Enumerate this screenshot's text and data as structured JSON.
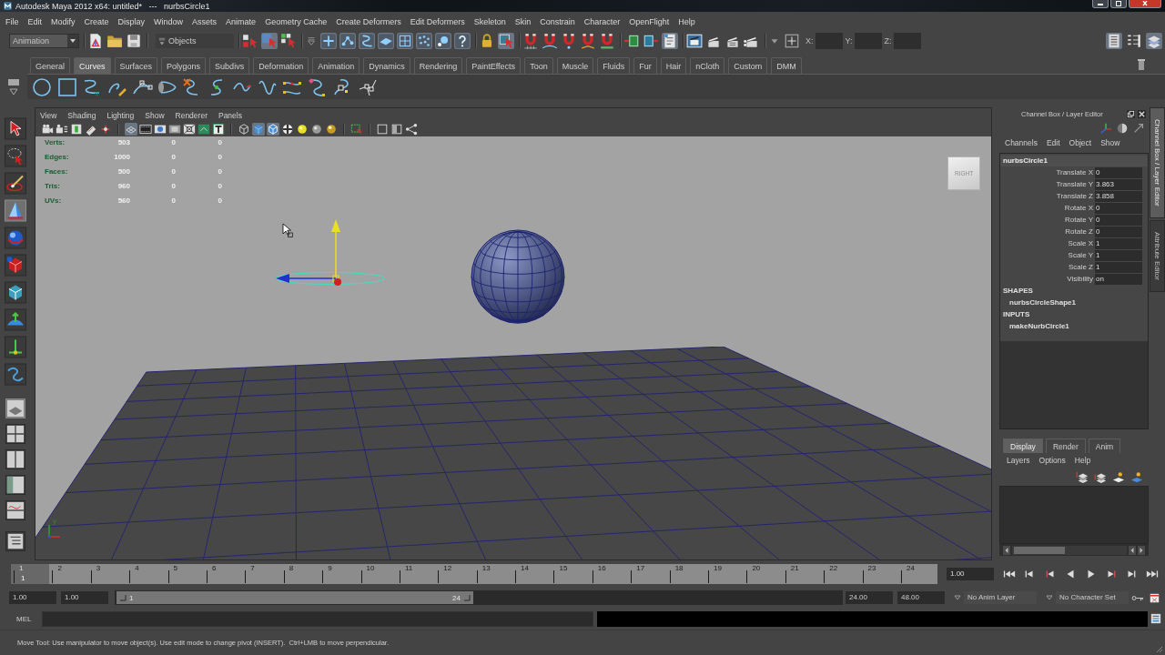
{
  "window": {
    "title": "Autodesk Maya 2012 x64: untitled*   ---   nurbsCircle1"
  },
  "menu_bar": [
    "File",
    "Edit",
    "Modify",
    "Create",
    "Display",
    "Window",
    "Assets",
    "Animate",
    "Geometry Cache",
    "Create Deformers",
    "Edit Deformers",
    "Skeleton",
    "Skin",
    "Constrain",
    "Character",
    "OpenFlight",
    "Help"
  ],
  "status_line": {
    "menu_set": "Animation",
    "selection_mode": "Objects",
    "button_groups": [
      [
        {
          "on": false
        },
        {
          "on": false
        },
        {
          "on": false
        }
      ],
      [
        {
          "on": false
        },
        {
          "on": true
        },
        {
          "on": false
        }
      ],
      [
        {
          "on": false
        },
        {
          "on": false
        },
        {
          "on": false
        },
        {
          "on": false
        },
        {
          "on": false
        },
        {
          "on": false
        },
        {
          "on": false
        },
        {
          "on": false
        }
      ],
      [
        {
          "on": false
        },
        {
          "on": true
        }
      ],
      [
        {
          "on": false
        },
        {
          "on": false
        },
        {
          "on": false
        },
        {
          "on": false
        },
        {
          "on": false
        }
      ],
      [
        {
          "on": false
        },
        {
          "on": false
        },
        {
          "on": true
        }
      ],
      [
        {
          "on": false
        },
        {
          "on": false
        },
        {
          "on": false
        },
        {
          "on": false
        }
      ]
    ],
    "coordinate_labels": [
      "X:",
      "Y:",
      "Z:"
    ],
    "panel_toggles": [
      {
        "on": true
      },
      {
        "on": false
      },
      {
        "on": true
      }
    ]
  },
  "shelf": {
    "tabs": [
      {
        "label": "General",
        "selected": false
      },
      {
        "label": "Curves",
        "selected": true
      },
      {
        "label": "Surfaces",
        "selected": false
      },
      {
        "label": "Polygons",
        "selected": false
      },
      {
        "label": "Subdivs",
        "selected": false
      },
      {
        "label": "Deformation",
        "selected": false
      },
      {
        "label": "Animation",
        "selected": false
      },
      {
        "label": "Dynamics",
        "selected": false
      },
      {
        "label": "Rendering",
        "selected": false
      },
      {
        "label": "PaintEffects",
        "selected": false
      },
      {
        "label": "Toon",
        "selected": false
      },
      {
        "label": "Muscle",
        "selected": false
      },
      {
        "label": "Fluids",
        "selected": false
      },
      {
        "label": "Fur",
        "selected": false
      },
      {
        "label": "Hair",
        "selected": false
      },
      {
        "label": "nCloth",
        "selected": false
      },
      {
        "label": "Custom",
        "selected": false
      },
      {
        "label": "DMM",
        "selected": false
      }
    ]
  },
  "toolbox": {
    "tools": [
      {
        "selected": false
      },
      {
        "selected": false
      },
      {
        "selected": false
      },
      {
        "selected": true
      },
      {
        "selected": false
      },
      {
        "selected": false
      },
      {
        "selected": false
      },
      {
        "selected": false
      },
      {
        "selected": false
      },
      {
        "selected": false
      }
    ],
    "layouts": [
      {
        "selected": true
      },
      {
        "selected": false
      },
      {
        "selected": false
      },
      {
        "selected": false
      },
      {
        "selected": false
      },
      {
        "selected": false
      }
    ]
  },
  "viewport": {
    "menus": [
      "View",
      "Shading",
      "Lighting",
      "Show",
      "Renderer",
      "Panels"
    ],
    "toolbar_groups": [
      [
        {
          "on": false
        },
        {
          "on": false
        },
        {
          "on": false
        },
        {
          "on": false
        },
        {
          "on": false
        }
      ],
      [
        {
          "on": true
        },
        {
          "on": false
        },
        {
          "on": false
        },
        {
          "on": false
        },
        {
          "on": false
        },
        {
          "on": false
        },
        {
          "on": false
        }
      ],
      [
        {
          "on": false
        },
        {
          "on": true
        },
        {
          "on": true
        },
        {
          "on": false
        },
        {
          "on": false
        },
        {
          "on": false
        },
        {
          "on": false
        }
      ],
      [
        {
          "on": false
        }
      ],
      [
        {
          "on": false
        },
        {
          "on": false
        },
        {
          "on": false
        }
      ]
    ],
    "hud": [
      {
        "label": "Verts:",
        "values": [
          "503",
          "0",
          "0"
        ]
      },
      {
        "label": "Edges:",
        "values": [
          "1000",
          "0",
          "0"
        ]
      },
      {
        "label": "Faces:",
        "values": [
          "500",
          "0",
          "0"
        ]
      },
      {
        "label": "Tris:",
        "values": [
          "960",
          "0",
          "0"
        ]
      },
      {
        "label": "UVs:",
        "values": [
          "560",
          "0",
          "0"
        ]
      }
    ],
    "view_cube": "RIGHT",
    "axis_label": "y"
  },
  "channel_box": {
    "title": "Channel Box / Layer Editor",
    "menus": [
      "Channels",
      "Edit",
      "Object",
      "Show"
    ],
    "node": "nurbsCircle1",
    "attributes": [
      {
        "name": "Translate X",
        "value": "0"
      },
      {
        "name": "Translate Y",
        "value": "3.863"
      },
      {
        "name": "Translate Z",
        "value": "3.858"
      },
      {
        "name": "Rotate X",
        "value": "0"
      },
      {
        "name": "Rotate Y",
        "value": "0"
      },
      {
        "name": "Rotate Z",
        "value": "0"
      },
      {
        "name": "Scale X",
        "value": "1"
      },
      {
        "name": "Scale Y",
        "value": "1"
      },
      {
        "name": "Scale Z",
        "value": "1"
      },
      {
        "name": "Visibility",
        "value": "on"
      }
    ],
    "sections": [
      {
        "heading": "SHAPES",
        "items": [
          "nurbsCircleShape1"
        ]
      },
      {
        "heading": "INPUTS",
        "items": [
          "makeNurbCircle1"
        ]
      }
    ]
  },
  "layer_editor": {
    "tabs": [
      {
        "label": "Display",
        "selected": true
      },
      {
        "label": "Render",
        "selected": false
      },
      {
        "label": "Anim",
        "selected": false
      }
    ],
    "menus": [
      "Layers",
      "Options",
      "Help"
    ]
  },
  "side_tabs": [
    {
      "label": "Channel Box / Layer Editor",
      "selected": true
    },
    {
      "label": "Attribute Editor",
      "selected": false
    }
  ],
  "time_slider": {
    "frames": [
      {
        "label": "1",
        "selected": true
      },
      {
        "label": "2",
        "selected": false
      },
      {
        "label": "3",
        "selected": false
      },
      {
        "label": "4",
        "selected": false
      },
      {
        "label": "5",
        "selected": false
      },
      {
        "label": "6",
        "selected": false
      },
      {
        "label": "7",
        "selected": false
      },
      {
        "label": "8",
        "selected": false
      },
      {
        "label": "9",
        "selected": false
      },
      {
        "label": "10",
        "selected": false
      },
      {
        "label": "11",
        "selected": false
      },
      {
        "label": "12",
        "selected": false
      },
      {
        "label": "13",
        "selected": false
      },
      {
        "label": "14",
        "selected": false
      },
      {
        "label": "15",
        "selected": false
      },
      {
        "label": "16",
        "selected": false
      },
      {
        "label": "17",
        "selected": false
      },
      {
        "label": "18",
        "selected": false
      },
      {
        "label": "19",
        "selected": false
      },
      {
        "label": "20",
        "selected": false
      },
      {
        "label": "21",
        "selected": false
      },
      {
        "label": "22",
        "selected": false
      },
      {
        "label": "23",
        "selected": false
      },
      {
        "label": "24",
        "selected": false
      }
    ],
    "marker_label": "1",
    "current_frame": "1.00"
  },
  "range_slider": {
    "start": "1.00",
    "playback_start": "1.00",
    "range_start": "1",
    "range_end": "24",
    "playback_end": "24.00",
    "end": "48.00",
    "anim_layer": "No Anim Layer",
    "character_set": "No Character Set"
  },
  "command_line": {
    "language": "MEL"
  },
  "help_line": "Move Tool: Use manipulator to move object(s). Use edit mode to change pivot (INSERT).  Ctrl+LMB to move perpendicular."
}
